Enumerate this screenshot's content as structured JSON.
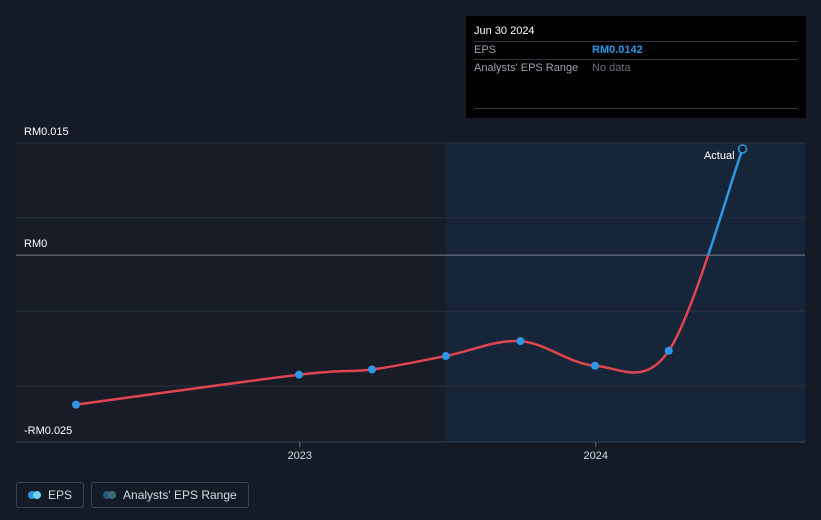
{
  "tooltip": {
    "date": "Jun 30 2024",
    "rows": [
      {
        "label": "EPS",
        "value": "RM0.0142"
      },
      {
        "label": "Analysts' EPS Range",
        "value": "No data"
      }
    ]
  },
  "chart_data": {
    "type": "line",
    "y_ticks": [
      {
        "value": 0.015,
        "label": "RM0.015"
      },
      {
        "value": 0,
        "label": "RM0"
      },
      {
        "value": -0.025,
        "label": "-RM0.025"
      }
    ],
    "x_ticks": [
      {
        "date": "2023-01-01",
        "label": "2023"
      },
      {
        "date": "2024-01-01",
        "label": "2024"
      }
    ],
    "series": [
      {
        "name": "EPS",
        "x": [
          "2022-03-31",
          "2022-12-31",
          "2023-03-31",
          "2023-06-30",
          "2023-09-30",
          "2023-12-31",
          "2024-03-31",
          "2024-06-30"
        ],
        "y": [
          -0.02,
          -0.016,
          -0.0153,
          -0.0135,
          -0.0115,
          -0.0148,
          -0.0128,
          0.0142
        ]
      }
    ],
    "ylim": [
      -0.025,
      0.015
    ],
    "forecast_region_start": "2023-06-30",
    "annotation": "Actual",
    "colors": {
      "past": "#e0454f",
      "recent": "#2e98e6",
      "forecast_bg": "#172538"
    }
  },
  "legend": [
    {
      "label": "EPS",
      "colors": [
        "#2e98e6",
        "#6ed3f0"
      ]
    },
    {
      "label": "Analysts' EPS Range",
      "colors": [
        "#1f5e7e",
        "#3b6b75"
      ]
    }
  ]
}
